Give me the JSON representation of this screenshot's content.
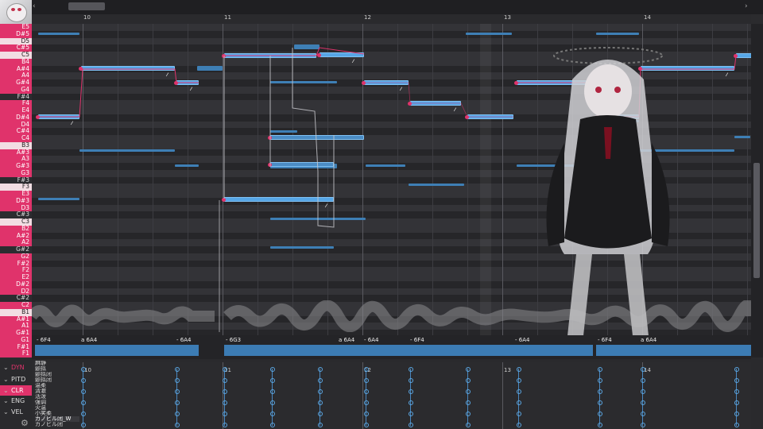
{
  "ruler": {
    "bars": [
      "10",
      "11",
      "12",
      "13",
      "14"
    ]
  },
  "keyboard": {
    "keys": [
      {
        "label": "E5",
        "type": "white"
      },
      {
        "label": "D#5",
        "type": "black"
      },
      {
        "label": "D5",
        "type": "white"
      },
      {
        "label": "C#5",
        "type": "black"
      },
      {
        "label": "C5",
        "type": "white"
      },
      {
        "label": "B4",
        "type": "white"
      },
      {
        "label": "A#4",
        "type": "black"
      },
      {
        "label": "A4",
        "type": "white"
      },
      {
        "label": "G#4",
        "type": "black"
      },
      {
        "label": "G4",
        "type": "white"
      },
      {
        "label": "F#4",
        "type": "black"
      },
      {
        "label": "F4",
        "type": "white"
      },
      {
        "label": "E4",
        "type": "white"
      },
      {
        "label": "D#4",
        "type": "black"
      },
      {
        "label": "D4",
        "type": "white"
      },
      {
        "label": "C#4",
        "type": "black"
      },
      {
        "label": "C4",
        "type": "white"
      },
      {
        "label": "B3",
        "type": "white"
      },
      {
        "label": "A#3",
        "type": "black"
      },
      {
        "label": "A3",
        "type": "white"
      },
      {
        "label": "G#3",
        "type": "black"
      },
      {
        "label": "G3",
        "type": "white"
      },
      {
        "label": "F#3",
        "type": "black"
      },
      {
        "label": "F3",
        "type": "white"
      },
      {
        "label": "E3",
        "type": "white"
      },
      {
        "label": "D#3",
        "type": "black"
      },
      {
        "label": "D3",
        "type": "white"
      },
      {
        "label": "C#3",
        "type": "black"
      },
      {
        "label": "C3",
        "type": "white"
      },
      {
        "label": "B2",
        "type": "white"
      },
      {
        "label": "A#2",
        "type": "black"
      },
      {
        "label": "A2",
        "type": "white"
      },
      {
        "label": "G#2",
        "type": "black"
      },
      {
        "label": "G2",
        "type": "white"
      },
      {
        "label": "F#2",
        "type": "black"
      },
      {
        "label": "F2",
        "type": "white"
      },
      {
        "label": "E2",
        "type": "white"
      },
      {
        "label": "D#2",
        "type": "black"
      },
      {
        "label": "D2",
        "type": "white"
      },
      {
        "label": "C#2",
        "type": "black"
      },
      {
        "label": "C2",
        "type": "white"
      },
      {
        "label": "B1",
        "type": "white"
      },
      {
        "label": "A#1",
        "type": "black"
      },
      {
        "label": "A1",
        "type": "white"
      },
      {
        "label": "G#1",
        "type": "black"
      },
      {
        "label": "G1",
        "type": "white"
      },
      {
        "label": "F#1",
        "type": "black"
      },
      {
        "label": "F1",
        "type": "white"
      }
    ]
  },
  "phonemes": [
    "- 6F4",
    "a 6A4",
    "- 6A4",
    "- 6G3",
    "a 6A4",
    "- 6A4",
    "- 6F4",
    "- 6A4",
    "- 6F4",
    "a 6A4"
  ],
  "params": [
    "DYN",
    "PITD",
    "CLR",
    "ENG",
    "VEL"
  ],
  "singer_list": [
    "麻静",
    "颤拟",
    "颤拟闭",
    "颤拟闭",
    "温柔",
    "清澈",
    "活泼",
    "强调",
    "火温",
    "小笑柔",
    "カノビル闭_W",
    "カノビル闭"
  ],
  "colors": {
    "accent": "#e0336b",
    "note": "#56a6e6",
    "background": "#2b2b2e"
  },
  "icons": {
    "settings": "gear-icon",
    "scroll_left": "chevron-left-icon",
    "scroll_right": "chevron-right-icon"
  }
}
